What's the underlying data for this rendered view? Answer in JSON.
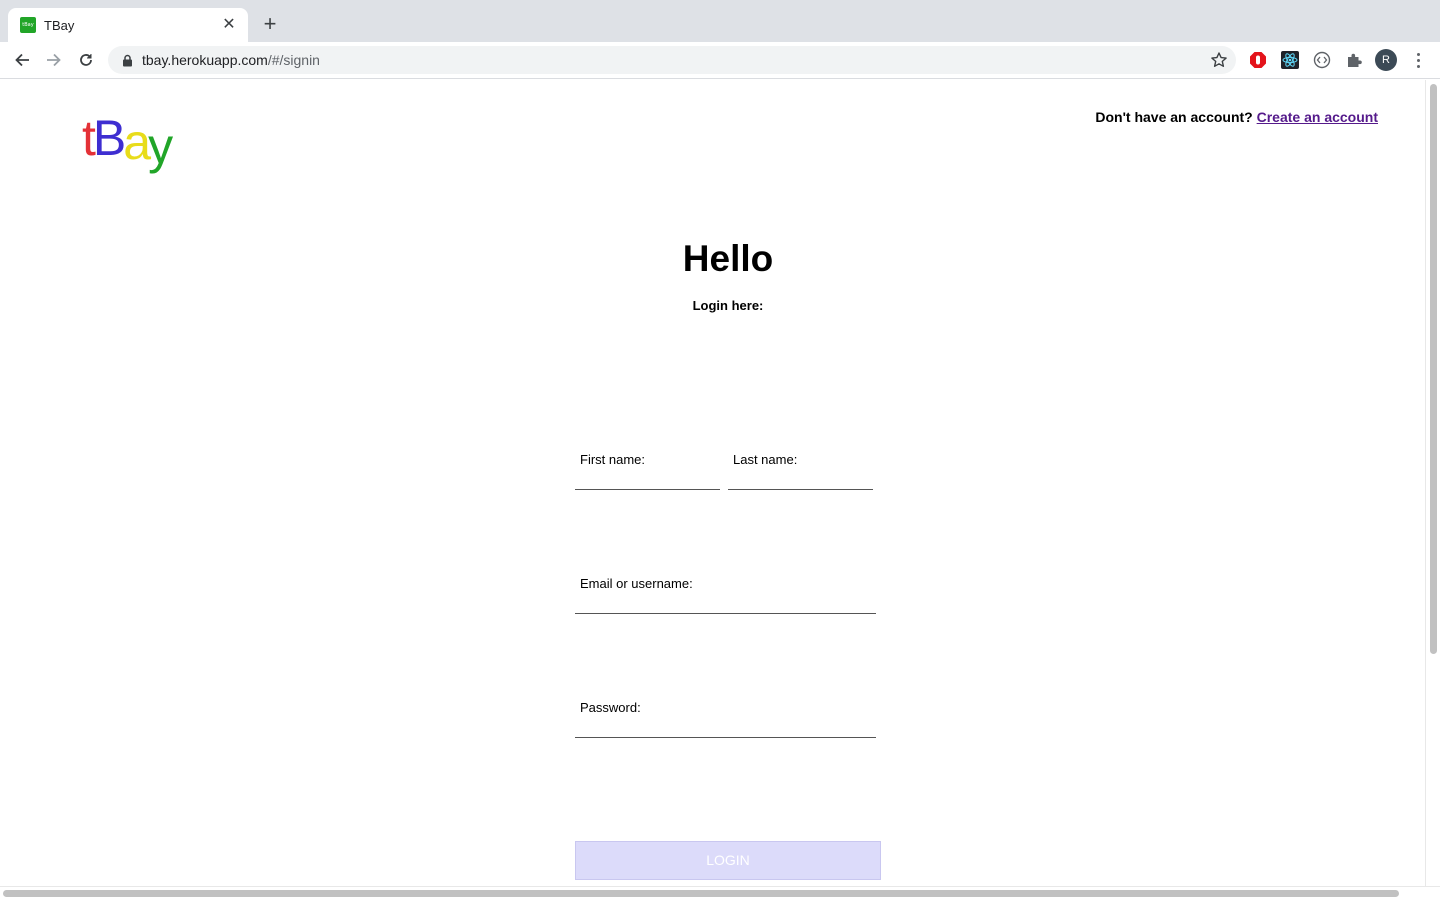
{
  "browser": {
    "tab_title": "TBay",
    "favicon_text": "tBay",
    "url_host": "tbay.herokuapp.com",
    "url_path": "/#/signin",
    "avatar_letter": "R"
  },
  "header": {
    "logo": [
      "t",
      "B",
      "a",
      "y"
    ],
    "signup_prompt": "Don't have an account?",
    "signup_link": "Create an account"
  },
  "main": {
    "title": "Hello",
    "subtitle": "Login here:"
  },
  "form": {
    "first_name_label": "First name:",
    "last_name_label": "Last name:",
    "email_label": "Email or username:",
    "password_label": "Password:",
    "login_button": "LOGIN"
  },
  "colors": {
    "logo_t": "#e43137",
    "logo_b": "#3e2ed1",
    "logo_a": "#e8dc1a",
    "logo_y": "#21a528",
    "button_bg": "#dcdbfa",
    "link": "#551a8b"
  }
}
